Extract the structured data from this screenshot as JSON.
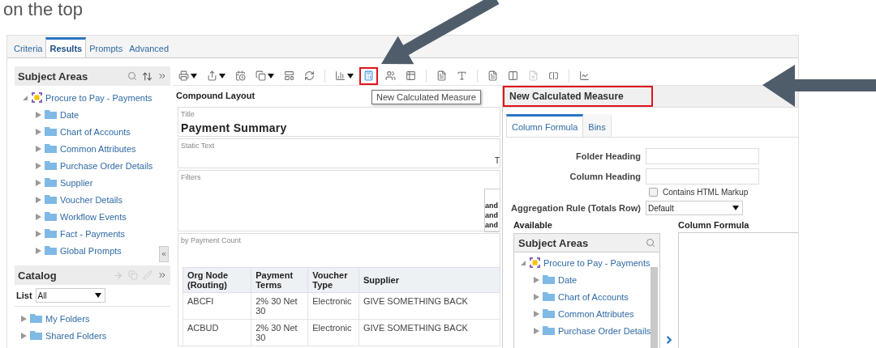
{
  "caption": "on the top",
  "tabs": [
    {
      "label": "Criteria",
      "selected": false
    },
    {
      "label": "Results",
      "selected": true
    },
    {
      "label": "Prompts",
      "selected": false
    },
    {
      "label": "Advanced",
      "selected": false
    }
  ],
  "subject_areas": {
    "title": "Subject Areas",
    "tree": [
      {
        "label": "Procure to Pay - Payments",
        "kind": "subject-area",
        "expanded": true,
        "children": [
          {
            "label": "Date",
            "kind": "folder",
            "expanded": false
          },
          {
            "label": "Chart of Accounts",
            "kind": "folder",
            "expanded": false
          },
          {
            "label": "Common Attributes",
            "kind": "folder",
            "expanded": false
          },
          {
            "label": "Purchase Order Details",
            "kind": "folder",
            "expanded": false
          },
          {
            "label": "Supplier",
            "kind": "folder",
            "expanded": false
          },
          {
            "label": "Voucher Details",
            "kind": "folder",
            "expanded": false
          },
          {
            "label": "Workflow Events",
            "kind": "folder",
            "expanded": false
          },
          {
            "label": "Fact - Payments",
            "kind": "folder",
            "expanded": false
          },
          {
            "label": "Global Prompts",
            "kind": "folder",
            "expanded": false
          }
        ]
      }
    ]
  },
  "catalog": {
    "title": "Catalog",
    "list_label": "List",
    "list_value": "All",
    "tree": [
      {
        "label": "My Folders",
        "kind": "folder",
        "expanded": false
      },
      {
        "label": "Shared Folders",
        "kind": "folder",
        "expanded": false
      }
    ]
  },
  "toolbar": {
    "tooltip": "New Calculated Measure",
    "groups": [
      [
        {
          "dropdown": true,
          "highlighted": false,
          "disabled": false
        },
        {
          "dropdown": true,
          "highlighted": false,
          "disabled": false
        },
        {
          "dropdown": false,
          "highlighted": false,
          "disabled": false
        },
        {
          "dropdown": true,
          "highlighted": false,
          "disabled": false
        },
        {
          "dropdown": false,
          "highlighted": false,
          "disabled": false
        },
        {
          "dropdown": false,
          "highlighted": false,
          "disabled": false
        }
      ],
      [
        {
          "dropdown": true,
          "highlighted": false,
          "disabled": false
        },
        {
          "dropdown": false,
          "highlighted": true,
          "disabled": false
        },
        {
          "dropdown": false,
          "highlighted": false,
          "disabled": false
        },
        {
          "dropdown": false,
          "highlighted": false,
          "disabled": false
        }
      ],
      [
        {
          "dropdown": false,
          "highlighted": false,
          "disabled": false
        },
        {
          "dropdown": false,
          "highlighted": false,
          "disabled": false
        }
      ],
      [
        {
          "dropdown": false,
          "highlighted": false,
          "disabled": false
        },
        {
          "dropdown": false,
          "highlighted": false,
          "disabled": false
        },
        {
          "dropdown": false,
          "highlighted": false,
          "disabled": true
        },
        {
          "dropdown": false,
          "highlighted": false,
          "disabled": false
        }
      ],
      [
        {
          "dropdown": false,
          "highlighted": false,
          "disabled": false
        }
      ]
    ]
  },
  "compound_layout": {
    "title": "Compound Layout",
    "title_view": {
      "label": "Title",
      "text": "Payment Summary"
    },
    "static_text_view": {
      "label": "Static Text",
      "text": "T"
    },
    "filters_view": {
      "label": "Filters",
      "lines": [
        "and",
        "and",
        "and"
      ]
    },
    "table_view": {
      "label": "by Payment Count",
      "columns": [
        "Org Node (Routing)",
        "Payment Terms",
        "Voucher Type",
        "Supplier"
      ],
      "rows": [
        [
          "ABCFI",
          "2% 30 Net 30",
          "Electronic",
          "GIVE SOMETHING BACK"
        ],
        [
          "ACBUD",
          "2% 30 Net 30",
          "Electronic",
          "GIVE SOMETHING BACK"
        ]
      ]
    }
  },
  "dialog": {
    "title": "New Calculated Measure",
    "highlighted": true,
    "tabs": [
      {
        "label": "Column Formula",
        "selected": true
      },
      {
        "label": "Bins",
        "selected": false
      }
    ],
    "fields": [
      {
        "label": "Folder Heading"
      },
      {
        "label": "Column Heading"
      }
    ],
    "checkbox": {
      "label": "Contains HTML Markup",
      "checked": false
    },
    "aggregation": {
      "label": "Aggregation Rule (Totals Row)",
      "value": "Default"
    },
    "available": {
      "label": "Available",
      "panel_title": "Subject Areas",
      "tree": [
        {
          "label": "Procure to Pay - Payments",
          "kind": "subject-area",
          "expanded": true,
          "children": [
            {
              "label": "Date",
              "kind": "folder",
              "expanded": false
            },
            {
              "label": "Chart of Accounts",
              "kind": "folder",
              "expanded": false
            },
            {
              "label": "Common Attributes",
              "kind": "folder",
              "expanded": false
            },
            {
              "label": "Purchase Order Details",
              "kind": "folder",
              "expanded": false
            }
          ]
        }
      ]
    },
    "formula": {
      "label": "Column Formula"
    }
  }
}
